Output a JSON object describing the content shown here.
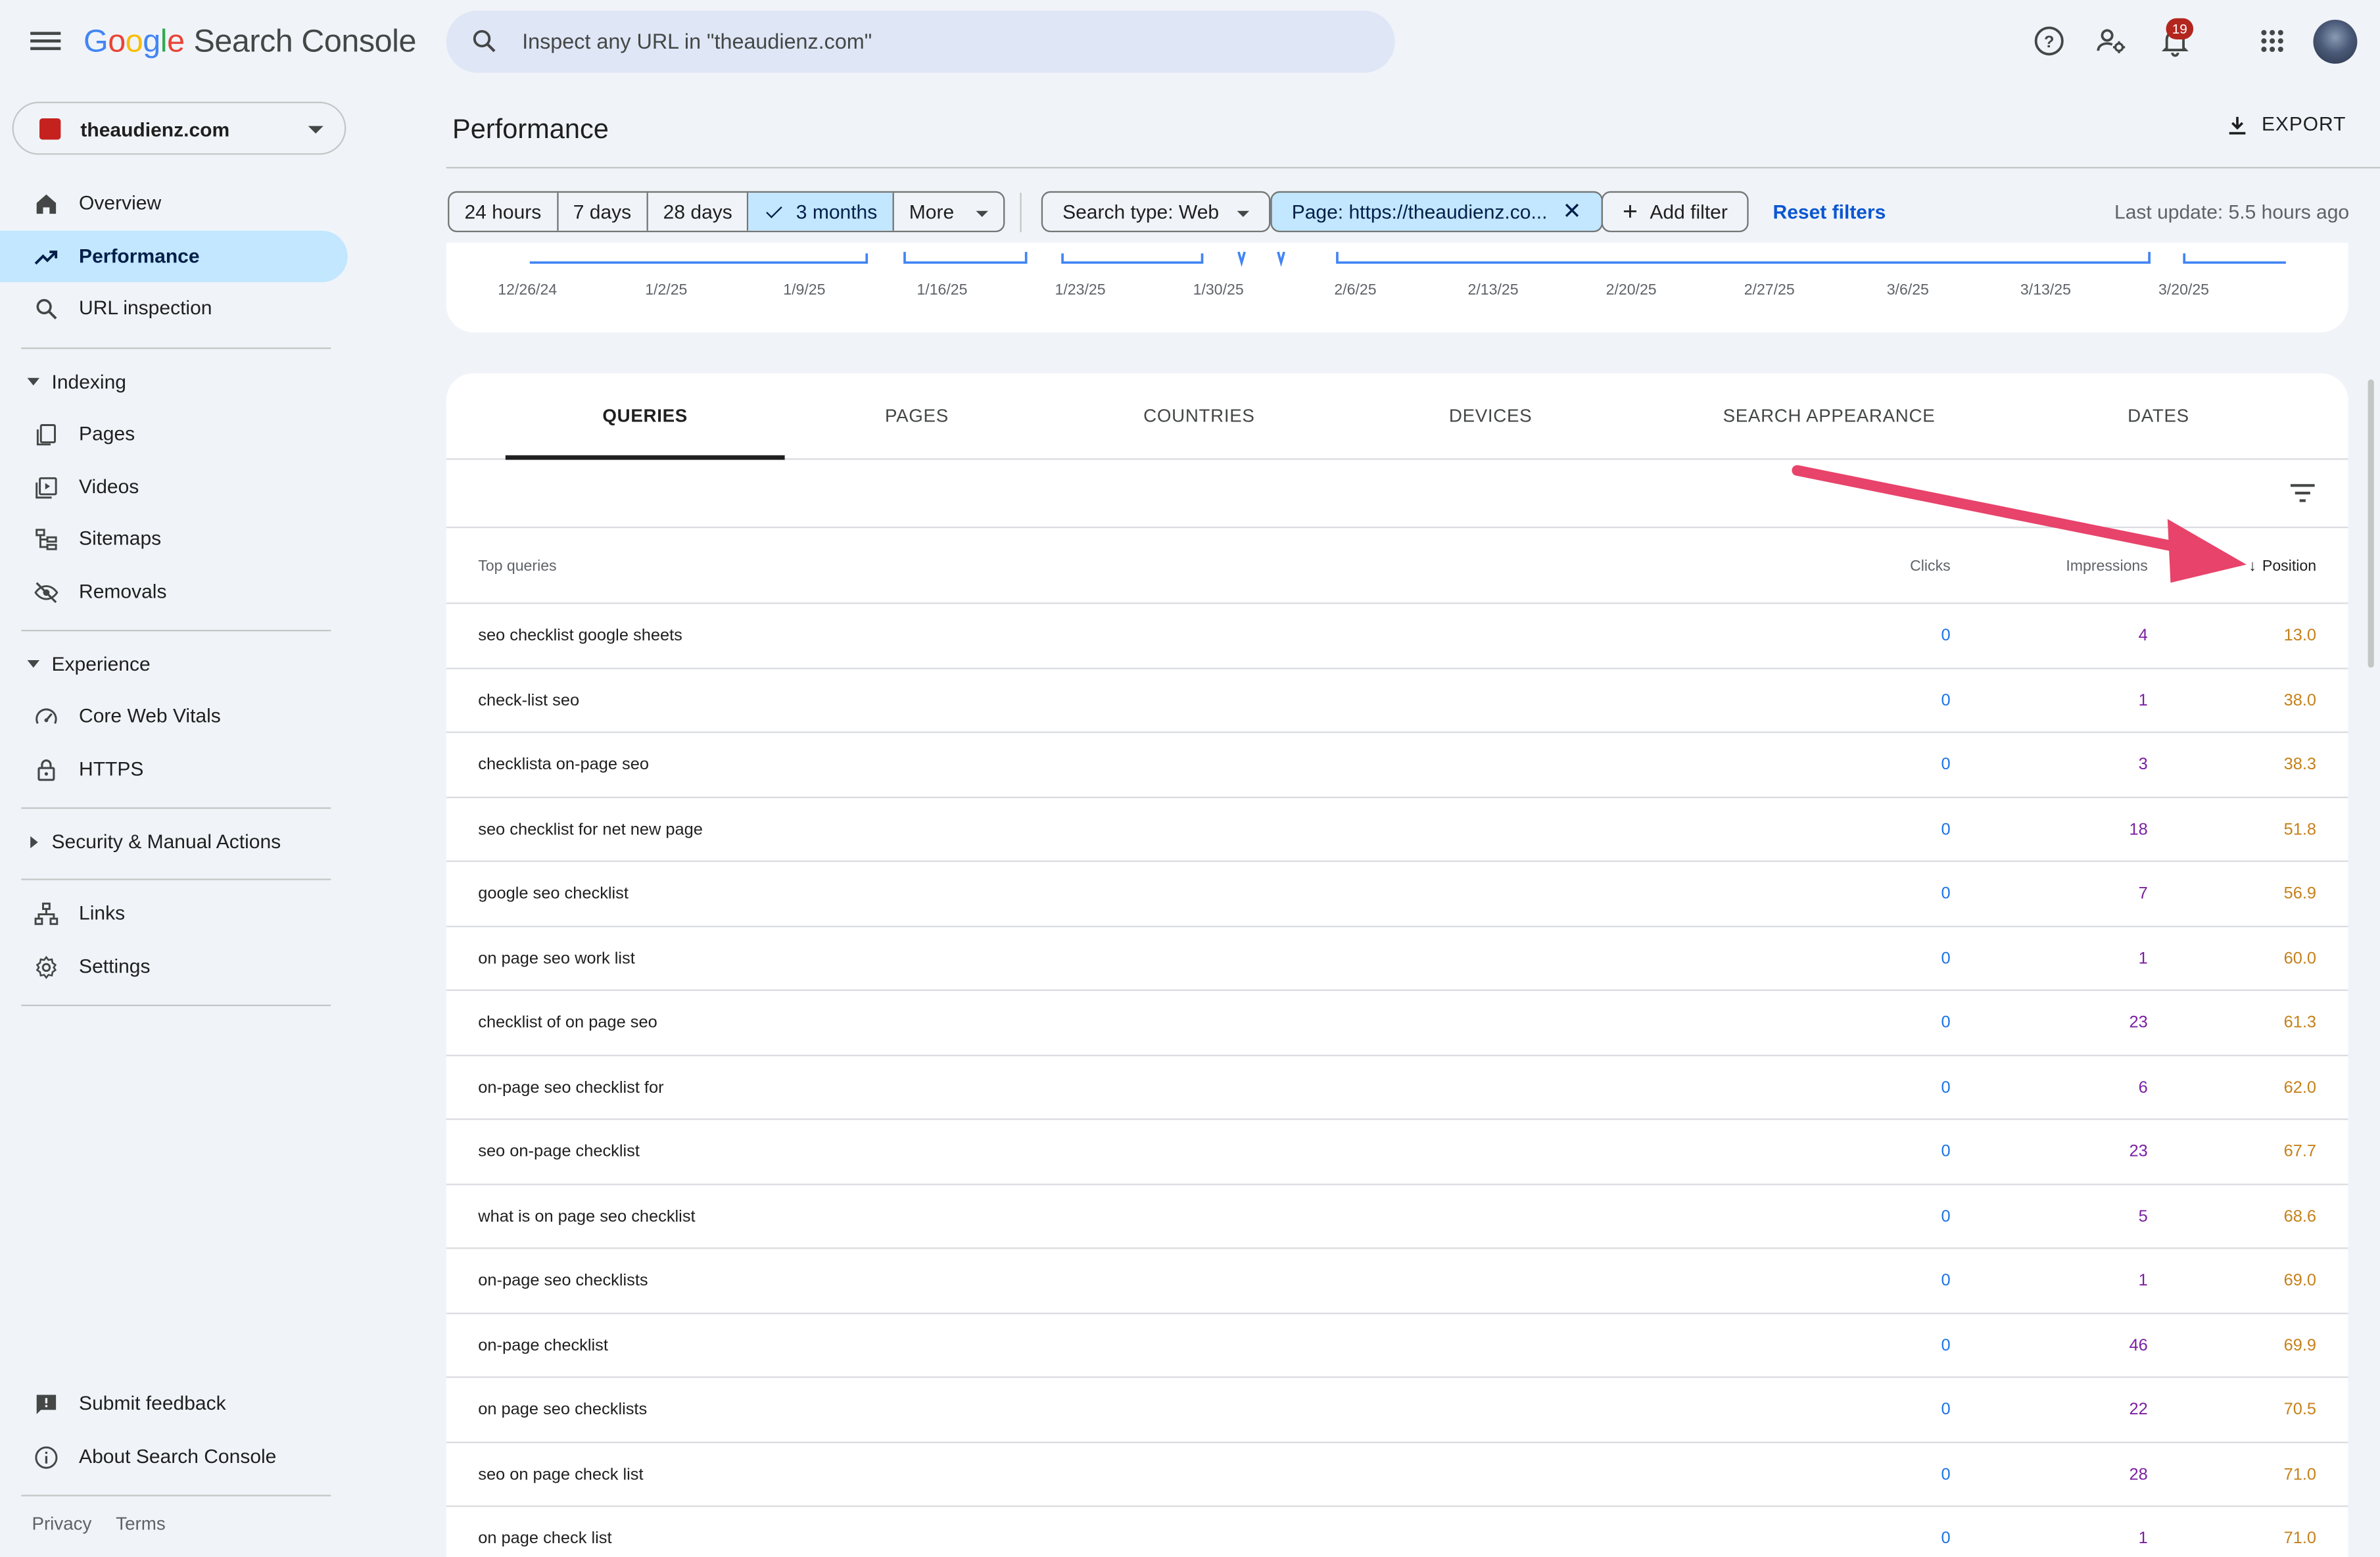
{
  "app": {
    "logo_letters": [
      "G",
      "o",
      "o",
      "g",
      "l",
      "e"
    ],
    "logo_rest": "Search Console",
    "search_placeholder": "Inspect any URL in \"theaudienz.com\"",
    "notifications_count": "19"
  },
  "property": {
    "name": "theaudienz.com"
  },
  "sidebar": {
    "top_items": [
      {
        "label": "Overview",
        "icon": "home-icon"
      },
      {
        "label": "Performance",
        "icon": "trending-up-icon",
        "active": true
      },
      {
        "label": "URL inspection",
        "icon": "search-icon"
      }
    ],
    "indexing": {
      "heading": "Indexing",
      "items": [
        {
          "label": "Pages",
          "icon": "pages-icon"
        },
        {
          "label": "Videos",
          "icon": "video-icon"
        },
        {
          "label": "Sitemaps",
          "icon": "sitemap-icon"
        },
        {
          "label": "Removals",
          "icon": "eye-off-icon"
        }
      ]
    },
    "experience": {
      "heading": "Experience",
      "items": [
        {
          "label": "Core Web Vitals",
          "icon": "speedometer-icon"
        },
        {
          "label": "HTTPS",
          "icon": "lock-icon"
        }
      ]
    },
    "security": {
      "heading": "Security & Manual Actions"
    },
    "bottom_items": [
      {
        "label": "Links",
        "icon": "links-icon"
      },
      {
        "label": "Settings",
        "icon": "gear-icon"
      }
    ],
    "footer_items": [
      {
        "label": "Submit feedback",
        "icon": "feedback-icon"
      },
      {
        "label": "About Search Console",
        "icon": "info-icon"
      }
    ],
    "footer_links": [
      "Privacy",
      "Terms"
    ]
  },
  "header": {
    "title": "Performance",
    "export_label": "EXPORT"
  },
  "filters": {
    "date_ranges": [
      "24 hours",
      "7 days",
      "28 days",
      "3 months",
      "More"
    ],
    "selected_range": "3 months",
    "search_type": "Search type: Web",
    "page_filter": "Page: https://theaudienz.co...",
    "add_filter": "Add filter",
    "reset": "Reset filters",
    "last_update": "Last update: 5.5 hours ago"
  },
  "chart": {
    "x_ticks": [
      "12/26/24",
      "1/2/25",
      "1/9/25",
      "1/16/25",
      "1/23/25",
      "1/30/25",
      "2/6/25",
      "2/13/25",
      "2/20/25",
      "2/27/25",
      "3/6/25",
      "3/13/25",
      "3/20/25"
    ],
    "line_color": "#4285f4"
  },
  "tabs": [
    "QUERIES",
    "PAGES",
    "COUNTRIES",
    "DEVICES",
    "SEARCH APPEARANCE",
    "DATES"
  ],
  "active_tab": "QUERIES",
  "table": {
    "headers": {
      "query": "Top queries",
      "clicks": "Clicks",
      "impressions": "Impressions",
      "position": "Position"
    },
    "sort_column": "Position",
    "rows": [
      {
        "query": "seo checklist google sheets",
        "clicks": "0",
        "impressions": "4",
        "position": "13.0"
      },
      {
        "query": "check-list seo",
        "clicks": "0",
        "impressions": "1",
        "position": "38.0"
      },
      {
        "query": "checklista on-page seo",
        "clicks": "0",
        "impressions": "3",
        "position": "38.3"
      },
      {
        "query": "seo checklist for net new page",
        "clicks": "0",
        "impressions": "18",
        "position": "51.8"
      },
      {
        "query": "google seo checklist",
        "clicks": "0",
        "impressions": "7",
        "position": "56.9"
      },
      {
        "query": "on page seo work list",
        "clicks": "0",
        "impressions": "1",
        "position": "60.0"
      },
      {
        "query": "checklist of on page seo",
        "clicks": "0",
        "impressions": "23",
        "position": "61.3"
      },
      {
        "query": "on-page seo checklist for",
        "clicks": "0",
        "impressions": "6",
        "position": "62.0"
      },
      {
        "query": "seo on-page checklist",
        "clicks": "0",
        "impressions": "23",
        "position": "67.7"
      },
      {
        "query": "what is on page seo checklist",
        "clicks": "0",
        "impressions": "5",
        "position": "68.6"
      },
      {
        "query": "on-page seo checklists",
        "clicks": "0",
        "impressions": "1",
        "position": "69.0"
      },
      {
        "query": "on-page checklist",
        "clicks": "0",
        "impressions": "46",
        "position": "69.9"
      },
      {
        "query": "on page seo checklists",
        "clicks": "0",
        "impressions": "22",
        "position": "70.5"
      },
      {
        "query": "seo on page check list",
        "clicks": "0",
        "impressions": "28",
        "position": "71.0"
      },
      {
        "query": "on page check list",
        "clicks": "0",
        "impressions": "1",
        "position": "71.0"
      }
    ]
  },
  "colors": {
    "accent": "#0b57d0",
    "active_nav": "#c2e7ff",
    "clicks": "#1a73e8",
    "impressions": "#7b1fa2",
    "position": "#c5811a",
    "annotation_arrow": "#e8436a"
  }
}
